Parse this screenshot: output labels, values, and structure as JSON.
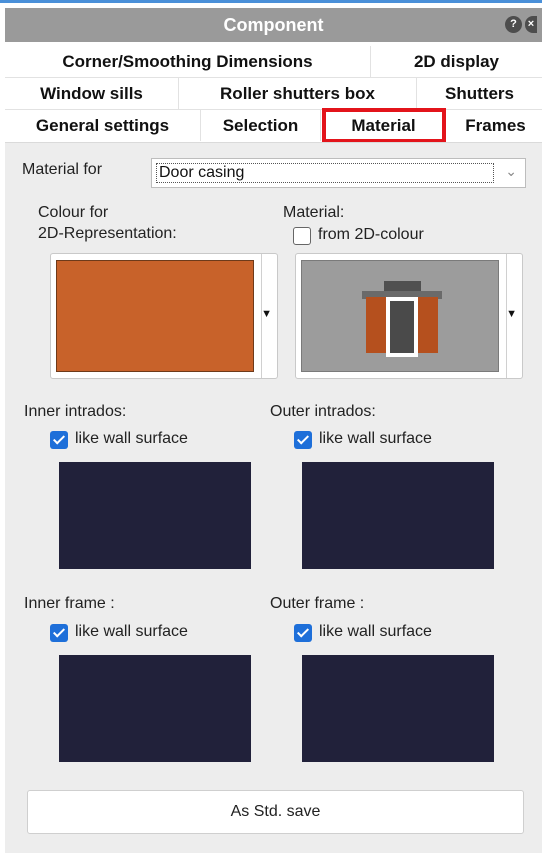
{
  "window": {
    "title": "Component",
    "help_icon": "help-icon",
    "close_icon": "close-icon"
  },
  "tabs": {
    "row1": [
      "Corner/Smoothing Dimensions",
      "2D display"
    ],
    "row2": [
      "Window sills",
      "Roller shutters box",
      "Shutters"
    ],
    "row3": [
      "General settings",
      "Selection",
      "Material",
      "Frames"
    ],
    "active": "Material"
  },
  "material_for": {
    "label": "Material for",
    "value": "Door casing"
  },
  "colour_2d": {
    "label_line1": "Colour for",
    "label_line2": "2D-Representation:",
    "color": "#c8622a"
  },
  "material": {
    "label": "Material:",
    "from_2d_label": "from 2D-colour",
    "from_2d_checked": false
  },
  "inner_intrados": {
    "label": "Inner intrados:",
    "like_wall_label": "like wall surface",
    "checked": true
  },
  "outer_intrados": {
    "label": "Outer intrados:",
    "like_wall_label": "like wall surface",
    "checked": true
  },
  "inner_frame": {
    "label": "Inner frame :",
    "like_wall_label": "like wall surface",
    "checked": true
  },
  "outer_frame": {
    "label": "Outer frame :",
    "like_wall_label": "like wall surface",
    "checked": true
  },
  "surface_color": "#21213a",
  "std_button": {
    "label": "As Std. save"
  }
}
